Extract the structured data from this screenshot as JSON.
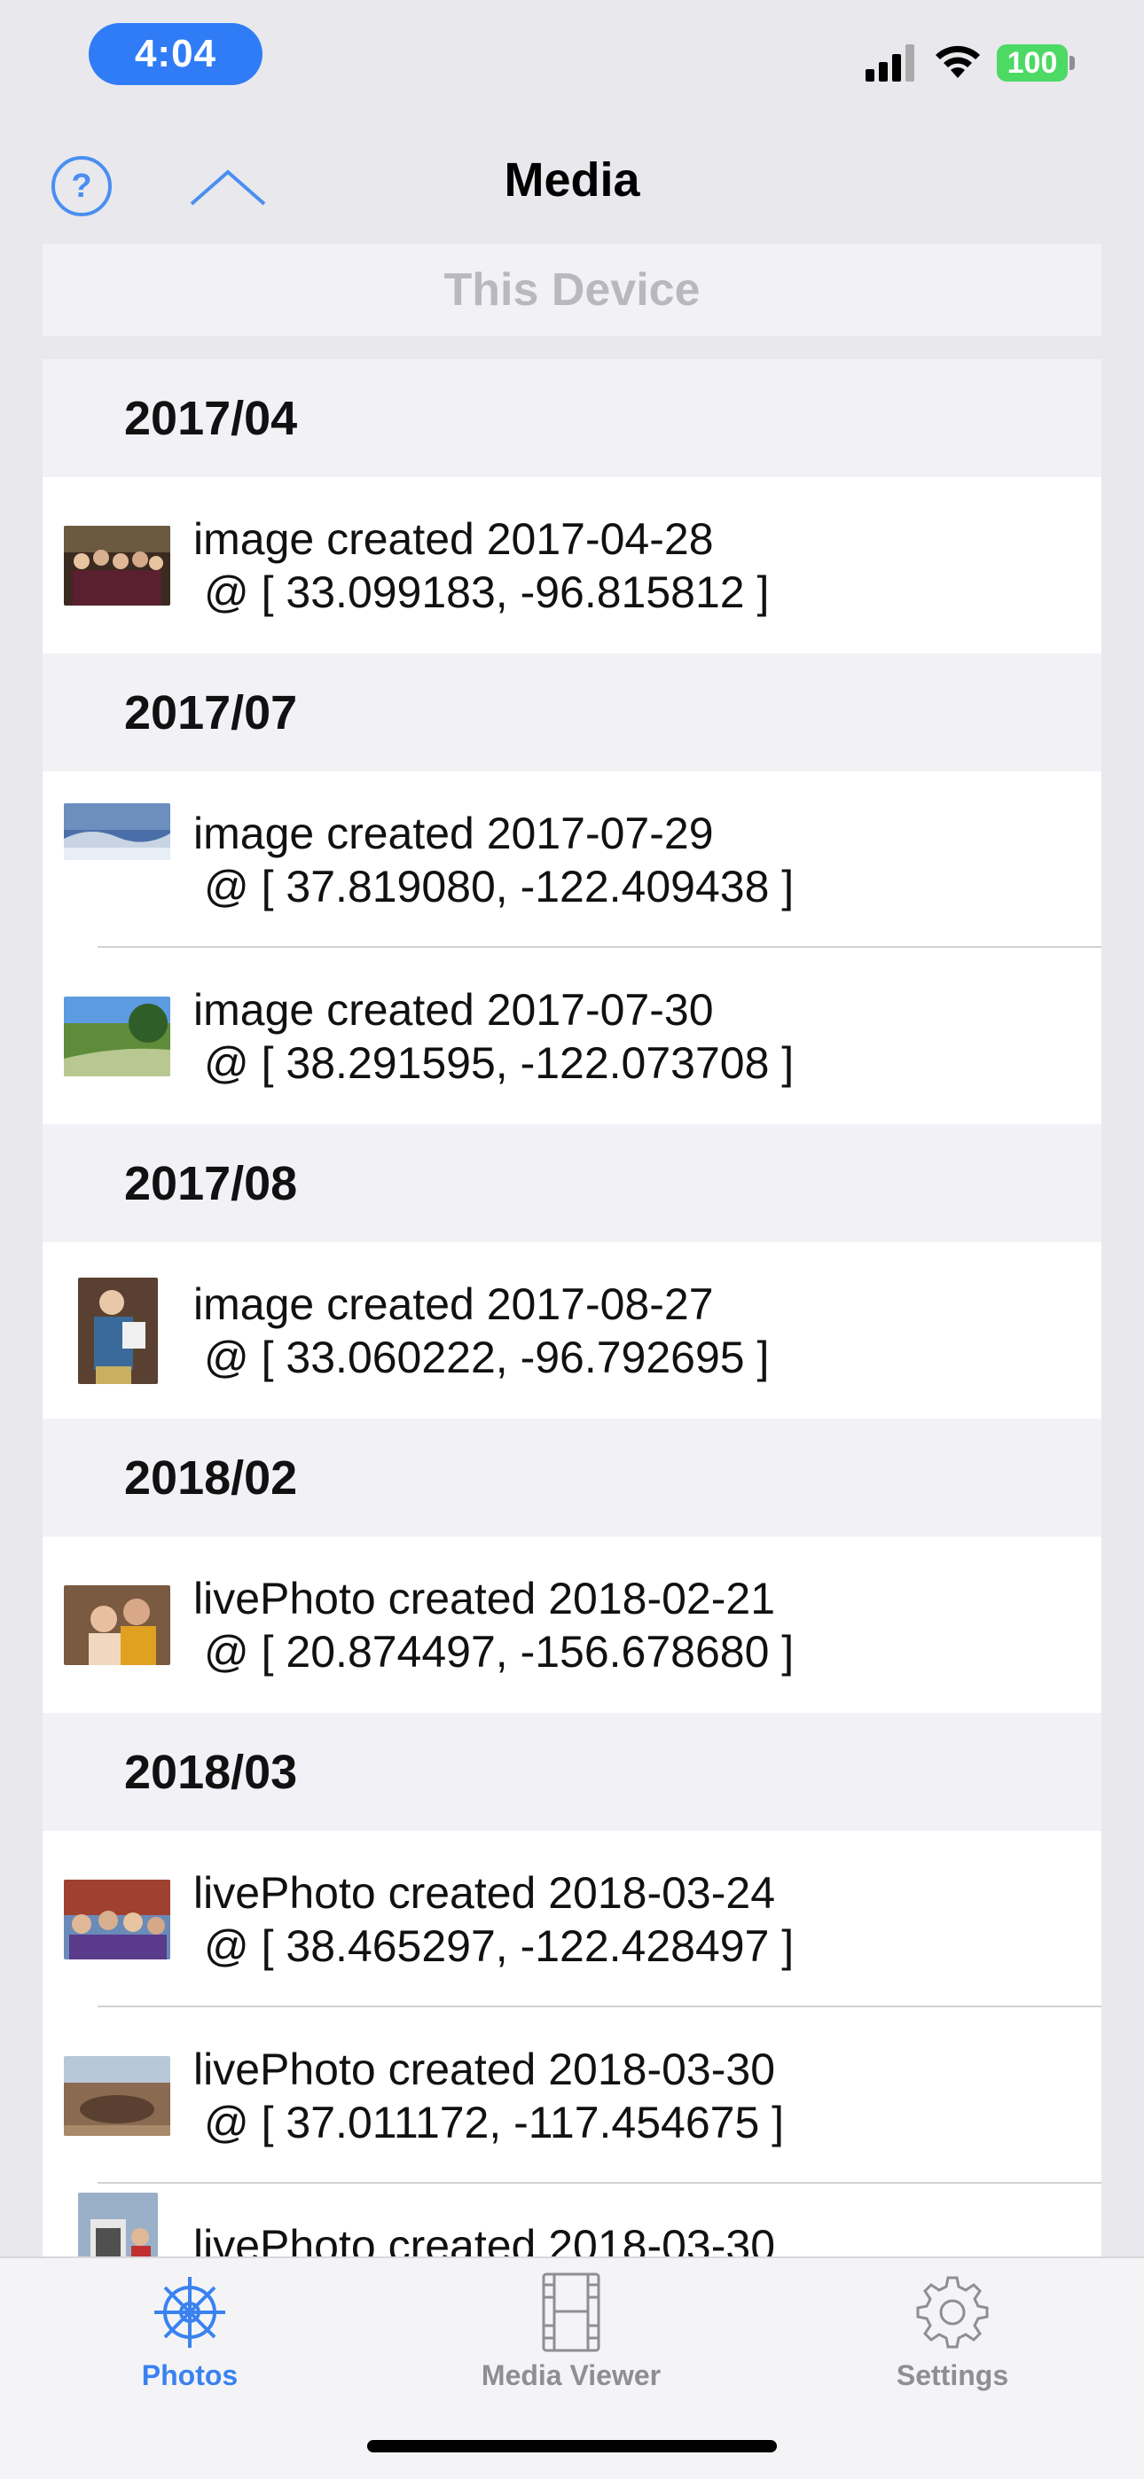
{
  "status_bar": {
    "time": "4:04",
    "battery": "100"
  },
  "nav": {
    "title": "Media",
    "help_label": "?"
  },
  "device_band": {
    "label": "This Device"
  },
  "sections": [
    {
      "header": "2017/04",
      "items": [
        {
          "line1": "image created 2017-04-28",
          "line2": "@ [ 33.099183, -96.815812 ]"
        }
      ]
    },
    {
      "header": "2017/07",
      "items": [
        {
          "line1": "image created 2017-07-29",
          "line2": "@ [ 37.819080, -122.409438 ]"
        },
        {
          "line1": "image created 2017-07-30",
          "line2": "@ [ 38.291595, -122.073708 ]"
        }
      ]
    },
    {
      "header": "2017/08",
      "items": [
        {
          "line1": "image created 2017-08-27",
          "line2": "@ [ 33.060222, -96.792695 ]"
        }
      ]
    },
    {
      "header": "2018/02",
      "items": [
        {
          "line1": "livePhoto created 2018-02-21",
          "line2": "@ [ 20.874497, -156.678680 ]"
        }
      ]
    },
    {
      "header": "2018/03",
      "items": [
        {
          "line1": "livePhoto created 2018-03-24",
          "line2": "@ [ 38.465297, -122.428497 ]"
        },
        {
          "line1": "livePhoto created 2018-03-30",
          "line2": "@ [ 37.011172, -117.454675 ]"
        },
        {
          "line1": "livePhoto created 2018-03-30",
          "line2": ""
        }
      ]
    }
  ],
  "tabs": [
    {
      "label": "Photos",
      "icon": "ships-wheel-icon",
      "active": true
    },
    {
      "label": "Media Viewer",
      "icon": "film-strip-icon",
      "active": false
    },
    {
      "label": "Settings",
      "icon": "gear-icon",
      "active": false
    }
  ],
  "colors": {
    "accent": "#3a82f0",
    "time_pill": "#2f7cf6",
    "battery": "#4cd964"
  }
}
